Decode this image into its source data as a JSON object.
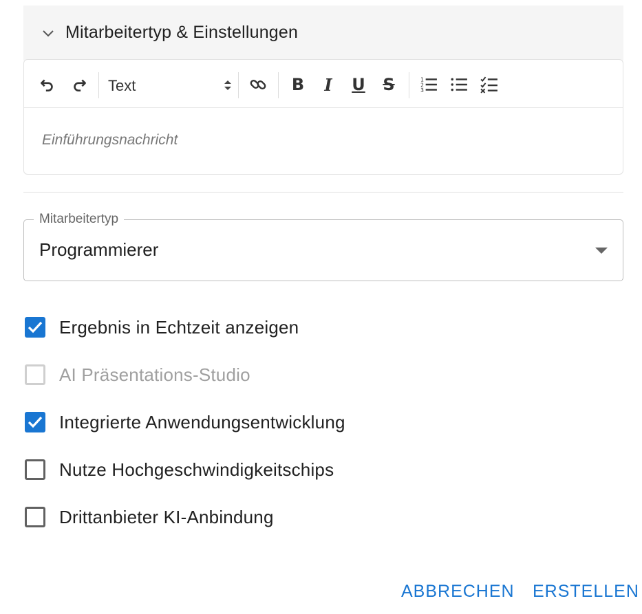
{
  "panel": {
    "title": "Mitarbeitertyp & Einstellungen",
    "icon": "chevron-down-icon"
  },
  "editor": {
    "toolbar": {
      "undo_icon": "undo-icon",
      "redo_icon": "redo-icon",
      "format_select": "Text",
      "link_icon": "link-icon",
      "bold": "B",
      "italic": "I",
      "underline": "U",
      "strikethrough": "S",
      "ordered_list_icon": "ordered-list-icon",
      "bullet_list_icon": "bullet-list-icon",
      "check_list_icon": "check-list-icon"
    },
    "placeholder": "Einführungsnachricht"
  },
  "employee_type": {
    "label": "Mitarbeitertyp",
    "value": "Programmierer"
  },
  "options": [
    {
      "label": "Ergebnis in Echtzeit anzeigen",
      "checked": true,
      "disabled": false
    },
    {
      "label": "AI Präsentations-Studio",
      "checked": false,
      "disabled": true
    },
    {
      "label": "Integrierte Anwendungsentwicklung",
      "checked": true,
      "disabled": false
    },
    {
      "label": "Nutze Hochgeschwindigkeitschips",
      "checked": false,
      "disabled": false
    },
    {
      "label": "Drittanbieter KI-Anbindung",
      "checked": false,
      "disabled": false
    }
  ],
  "actions": {
    "cancel": "ABBRECHEN",
    "create": "ERSTELLEN"
  },
  "colors": {
    "accent": "#1976d2",
    "header_bg": "#f5f5f5"
  }
}
